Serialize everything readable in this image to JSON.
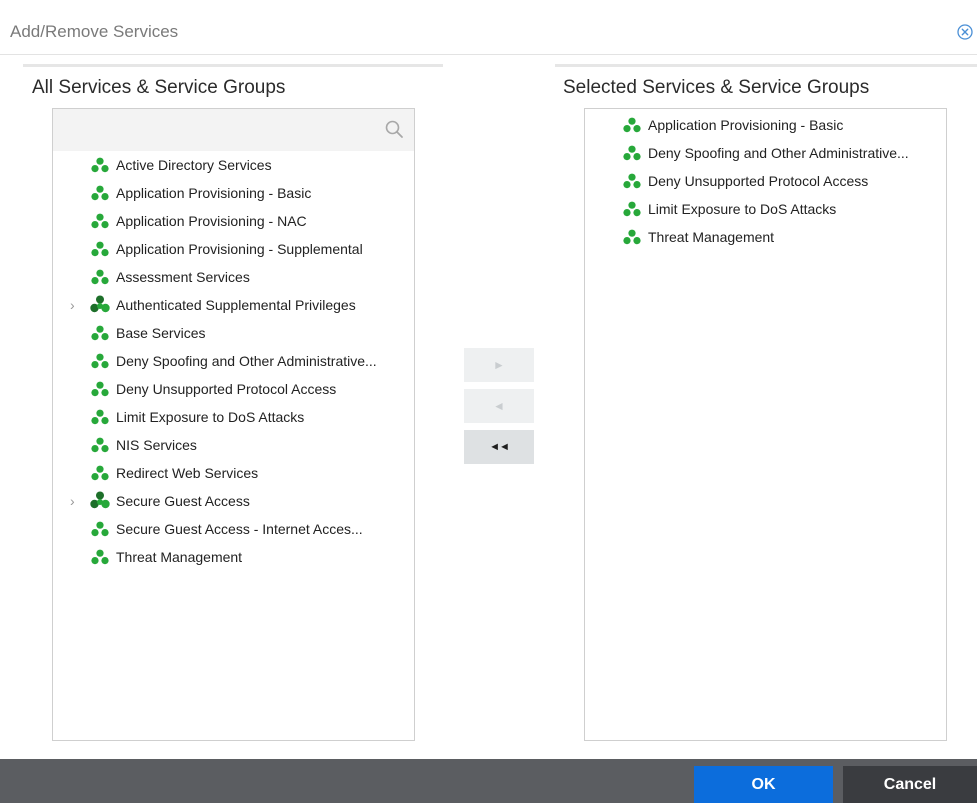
{
  "dialog": {
    "title": "Add/Remove Services"
  },
  "left_pane": {
    "title": "All Services & Service Groups",
    "search": {
      "value": "",
      "placeholder": ""
    },
    "items": [
      {
        "label": "Active Directory Services",
        "type": "service"
      },
      {
        "label": "Application Provisioning - Basic",
        "type": "service"
      },
      {
        "label": "Application Provisioning - NAC",
        "type": "service"
      },
      {
        "label": "Application Provisioning - Supplemental",
        "type": "service"
      },
      {
        "label": "Assessment Services",
        "type": "service"
      },
      {
        "label": "Authenticated Supplemental Privileges",
        "type": "group",
        "expandable": true
      },
      {
        "label": "Base Services",
        "type": "service"
      },
      {
        "label": "Deny Spoofing and Other Administrative...",
        "type": "service"
      },
      {
        "label": "Deny Unsupported Protocol Access",
        "type": "service"
      },
      {
        "label": "Limit Exposure to DoS Attacks",
        "type": "service"
      },
      {
        "label": "NIS Services",
        "type": "service"
      },
      {
        "label": "Redirect Web Services",
        "type": "service"
      },
      {
        "label": "Secure Guest Access",
        "type": "group",
        "expandable": true
      },
      {
        "label": "Secure Guest Access - Internet Acces...",
        "type": "service"
      },
      {
        "label": "Threat Management",
        "type": "service"
      }
    ]
  },
  "right_pane": {
    "title": "Selected Services & Service Groups",
    "items": [
      {
        "label": "Application Provisioning - Basic",
        "type": "service"
      },
      {
        "label": "Deny Spoofing and Other Administrative...",
        "type": "service"
      },
      {
        "label": "Deny Unsupported Protocol Access",
        "type": "service"
      },
      {
        "label": "Limit Exposure to DoS Attacks",
        "type": "service"
      },
      {
        "label": "Threat Management",
        "type": "service"
      }
    ]
  },
  "move_buttons": {
    "add": {
      "glyph": "►",
      "enabled": false
    },
    "remove": {
      "glyph": "◄",
      "enabled": false
    },
    "remove_all": {
      "glyph": "◄◄",
      "enabled": true
    }
  },
  "footer": {
    "ok_label": "OK",
    "cancel_label": "Cancel"
  },
  "colors": {
    "service_icon": "#27a83a",
    "group_icon_dark": "#1d6f2a",
    "ok_button": "#0c6ddc",
    "cancel_button": "#3a3c40",
    "footer_bar": "#5b5d61",
    "close_icon": "#4a8fd6"
  },
  "icons": {
    "service": "service-icon",
    "group": "service-group-icon",
    "expand": "chevron-right-icon",
    "search": "search-icon",
    "close": "close-circle-icon"
  }
}
